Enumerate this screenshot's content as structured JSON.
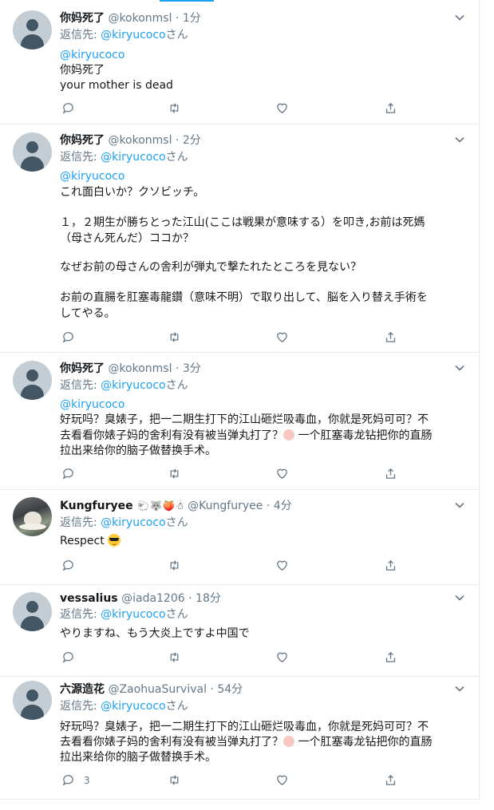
{
  "tweets": [
    {
      "name": "你妈死了",
      "handle": "@kokonmsl",
      "time": "1分",
      "reply_prefix": "返信先: ",
      "reply_link": "@kiryucoco",
      "reply_suffix": "さん",
      "mention": "@kiryucoco",
      "lines": [
        "你妈死了",
        "your mother is dead"
      ],
      "reply_count": ""
    },
    {
      "name": "你妈死了",
      "handle": "@kokonmsl",
      "time": "2分",
      "reply_prefix": "返信先: ",
      "reply_link": "@kiryucoco",
      "reply_suffix": "さん",
      "mention": "@kiryucoco",
      "lines": [
        "これ面白いか？クソビッチ。",
        "",
        "１，２期生が勝ちとった江山(ここは戦果が意味する）を叩き,お前は死媽",
        "（母さん死んだ）ココか？",
        "",
        "なぜお前の母さんの舎利が弾丸で撃たれたところを見ない？",
        "",
        "お前の直腸を肛塞毒龍鑽（意味不明）で取り出して、脳を入り替え手術を",
        "してやる。"
      ],
      "reply_count": ""
    },
    {
      "name": "你妈死了",
      "handle": "@kokonmsl",
      "time": "3分",
      "reply_prefix": "返信先: ",
      "reply_link": "@kiryucoco",
      "reply_suffix": "さん",
      "mention": "@kiryucoco",
      "lines": [
        "好玩吗？臭婊子，把一二期生打下的江山砸烂吸毒血，你就是死妈可可？不",
        "去看看你婊子妈的舍利有没有被当弹丸打了？",
        "拉出来给你的脑子做替换手术。"
      ],
      "line2_tail": "一个肛塞毒龙钻把你的直肠",
      "reply_count": ""
    },
    {
      "name": "Kungfuryee",
      "badges": [
        "🐑",
        "🐺",
        "🍑",
        "☃"
      ],
      "handle": "@Kungfuryee",
      "time": "4分",
      "reply_prefix": "返信先: ",
      "reply_link": "@kiryucoco",
      "reply_suffix": "さん",
      "lines": [
        "Respect"
      ],
      "reply_count": ""
    },
    {
      "name": "vessalius",
      "handle": "@iada1206",
      "time": "18分",
      "reply_prefix": "返信先: ",
      "reply_link": "@kiryucoco",
      "reply_suffix": "さん",
      "lines": [
        "やりますね、もう大炎上ですよ中国で"
      ],
      "reply_count": ""
    },
    {
      "name": "六源造花",
      "handle": "@ZaohuaSurvival",
      "time": "54分",
      "reply_prefix": "返信先: ",
      "reply_link": "@kiryucoco",
      "reply_suffix": "さん",
      "lines": [
        "好玩吗？臭婊子，把一二期生打下的江山砸烂吸毒血，你就是死妈可可？不",
        "去看看你婊子妈的舍利有没有被当弹丸打了？",
        "拉出来给你的脑子做替换手术。"
      ],
      "line2_tail": "一个肛塞毒龙钻把你的直肠",
      "reply_count": "3"
    }
  ],
  "separator": " · ",
  "colors": {
    "link": "#1da1f2",
    "muted": "#657786",
    "border": "#e6ecf0"
  }
}
